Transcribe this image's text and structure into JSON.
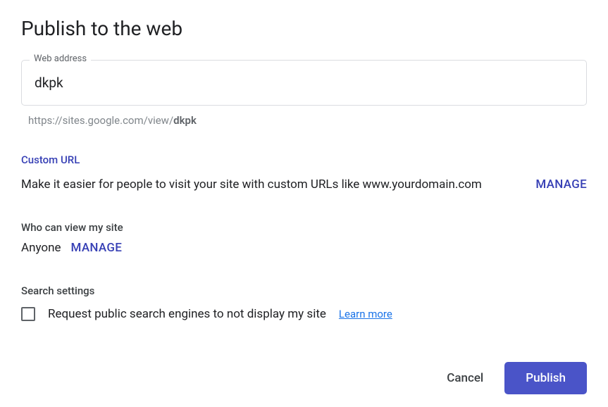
{
  "dialog": {
    "title": "Publish to the web"
  },
  "webAddress": {
    "label": "Web address",
    "value": "dkpk",
    "previewPrefix": "https://sites.google.com/view/",
    "previewSlug": "dkpk"
  },
  "customUrl": {
    "heading": "Custom URL",
    "description": "Make it easier for people to visit your site with custom URLs like www.yourdomain.com",
    "manageLabel": "MANAGE"
  },
  "viewers": {
    "heading": "Who can view my site",
    "value": "Anyone",
    "manageLabel": "MANAGE"
  },
  "searchSettings": {
    "heading": "Search settings",
    "checkboxLabel": "Request public search engines to not display my site",
    "learnMoreLabel": "Learn more"
  },
  "actions": {
    "cancel": "Cancel",
    "publish": "Publish"
  }
}
